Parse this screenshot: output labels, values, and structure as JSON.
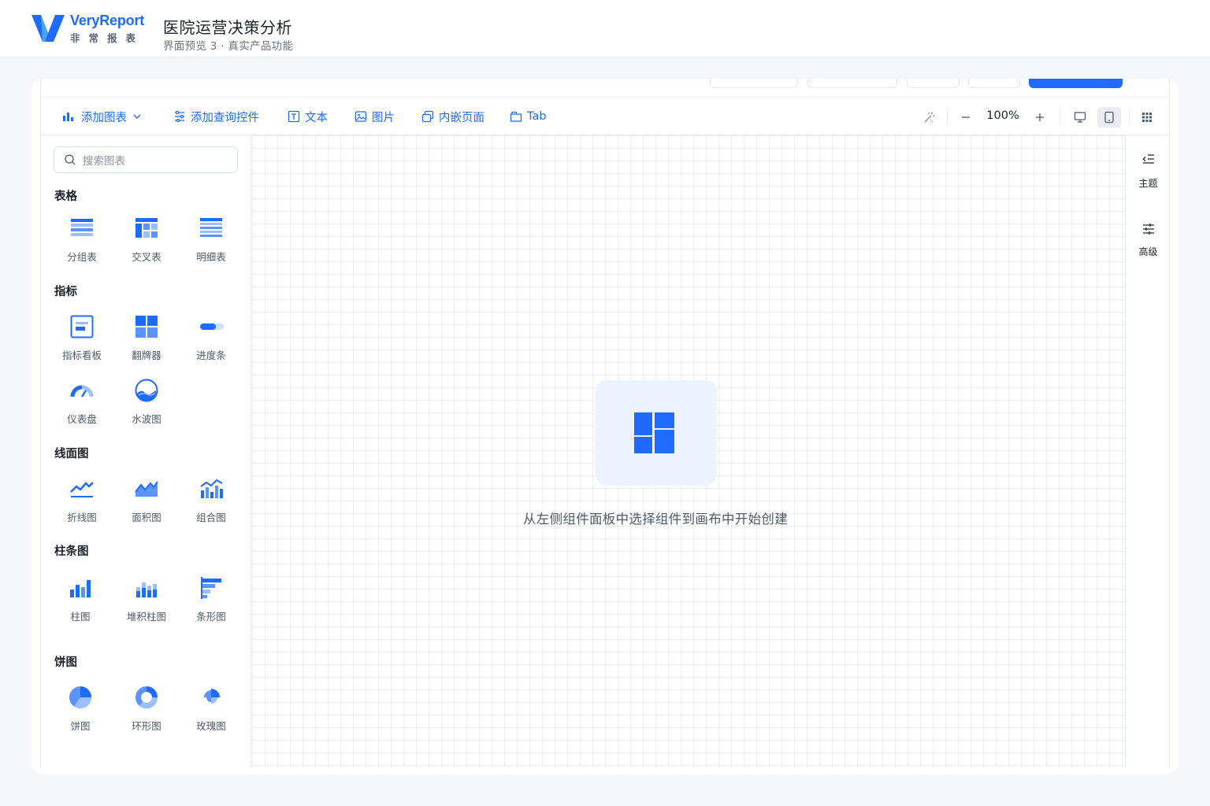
{
  "brand": {
    "name_en": "VeryReport",
    "name_cn": "非常报表",
    "accent": "#1f6bff"
  },
  "header": {
    "title": "医院运营决策分析",
    "subtitle": "界面预览 3 · 真实产品功能"
  },
  "toolbar": {
    "add_chart": "添加图表",
    "add_query": "添加查询控件",
    "text": "文本",
    "image": "图片",
    "embed": "内嵌页面",
    "tab": "Tab",
    "zoom": "100%"
  },
  "search": {
    "placeholder": "搜索图表"
  },
  "sections": {
    "table": {
      "title": "表格",
      "items": [
        "分组表",
        "交叉表",
        "明细表"
      ]
    },
    "metric": {
      "title": "指标",
      "items": [
        "指标看板",
        "翻牌器",
        "进度条",
        "仪表盘",
        "水波图"
      ]
    },
    "line": {
      "title": "线面图",
      "items": [
        "折线图",
        "面积图",
        "组合图"
      ]
    },
    "bar": {
      "title": "柱条图",
      "items": [
        "柱图",
        "堆积柱图",
        "条形图"
      ]
    },
    "pie": {
      "title": "饼图",
      "items": [
        "饼图",
        "环形图",
        "玫瑰图"
      ]
    }
  },
  "canvas": {
    "empty_text": "从左侧组件面板中选择组件到画布中开始创建"
  },
  "right_rail": {
    "theme": "主题",
    "advanced": "高级"
  }
}
